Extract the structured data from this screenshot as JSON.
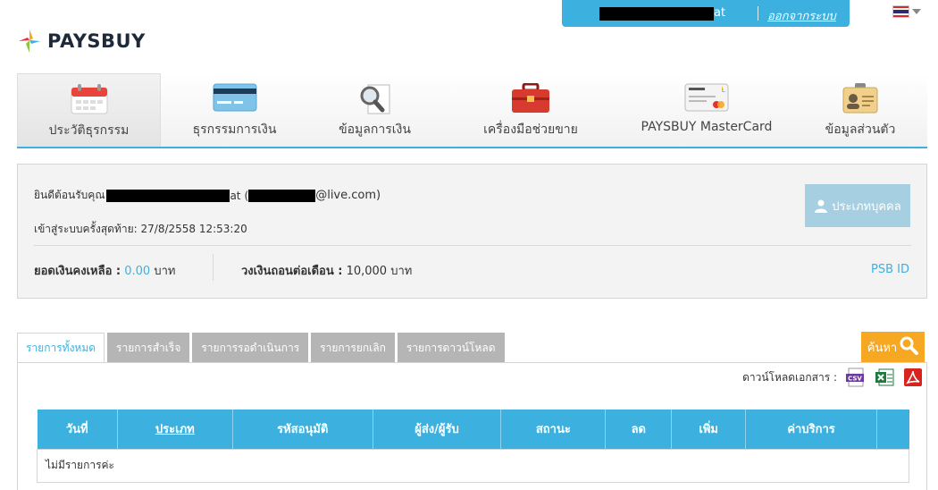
{
  "userbar": {
    "username_suffix": "at",
    "logout": "ออกจากระบบ"
  },
  "brand": {
    "name": "PAYSBUY"
  },
  "nav": [
    {
      "label": "ประวัติธุรกรรม",
      "icon": "calendar-icon"
    },
    {
      "label": "ธุรกรรมการเงิน",
      "icon": "credit-card-icon"
    },
    {
      "label": "ข้อมูลการเงิน",
      "icon": "magnifier-document-icon"
    },
    {
      "label": "เครื่องมือช่วยขาย",
      "icon": "toolbox-icon"
    },
    {
      "label": "PAYSBUY MasterCard",
      "icon": "mastercard-icon"
    },
    {
      "label": "ข้อมูลส่วนตัว",
      "icon": "id-badge-icon"
    }
  ],
  "account": {
    "welcome_prefix": "ยินดีต้อนรับคุณ",
    "welcome_name_suffix": "at",
    "email_open": "(",
    "email_suffix": "@live.com)",
    "last_login_label": "เข้าสู่ระบบครั้งสุดท้าย:",
    "last_login_value": "27/8/2558 12:53:20",
    "type_button": "ประเภทบุคคล",
    "balance_label": "ยอดเงินคงเหลือ :",
    "balance_value": "0.00",
    "balance_unit": "บาท",
    "credit_label": "วงเงินถอนต่อเดือน :",
    "credit_value": "10,000",
    "credit_unit": "บาท",
    "psb_id": "PSB ID"
  },
  "tabs": [
    "รายการทั้งหมด",
    "รายการสำเร็จ",
    "รายการรอดำเนินการ",
    "รายการยกเลิก",
    "รายการดาวน์โหลด"
  ],
  "search_button": "ค้นหา",
  "download": {
    "label": "ดาวน์โหลดเอกสาร :",
    "formats": [
      "CSV",
      "Excel",
      "PDF"
    ]
  },
  "table": {
    "headers": [
      "วันที่",
      "ประเภท",
      "รหัสอนุมัติ",
      "ผู้ส่ง/ผู้รับ",
      "สถานะ",
      "ลด",
      "เพิ่ม",
      "ค่าบริการ",
      ""
    ],
    "empty_message": "ไม่มีรายการค่ะ"
  },
  "colors": {
    "accent": "#3cb1e0",
    "search": "#f7a822",
    "tab_inactive": "#b5b5b5"
  }
}
